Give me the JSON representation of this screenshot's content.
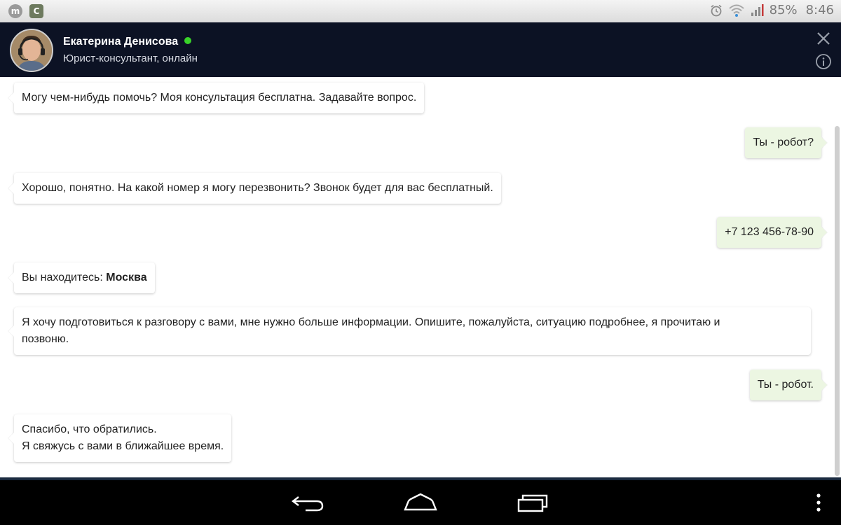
{
  "status_bar": {
    "battery": "85%",
    "time": "8:46",
    "icons": [
      "app-m-icon",
      "app-c-icon",
      "alarm-icon",
      "wifi-icon",
      "signal-icon"
    ]
  },
  "header": {
    "agent_name": "Екатерина Денисова",
    "agent_role": "Юрист-консультант, онлайн",
    "status_color": "#39d429",
    "background_color": "#0c1224"
  },
  "messages": [
    {
      "side": "in",
      "lines": [
        "Могу чем-нибудь помочь? Моя консультация бесплатна. Задавайте вопрос."
      ]
    },
    {
      "side": "out",
      "lines": [
        "Ты - робот?"
      ]
    },
    {
      "side": "in",
      "lines": [
        "Хорошо, понятно. На какой номер я могу перезвонить? Звонок будет для вас бесплатный."
      ]
    },
    {
      "side": "out",
      "lines": [
        "+7 123 456-78-90"
      ]
    },
    {
      "side": "in",
      "prefix": "Вы находитесь: ",
      "bold": "Москва"
    },
    {
      "side": "in",
      "lines": [
        "Я хочу подготовиться к разговору с вами, мне нужно больше информации. Опишите, пожалуйста, ситуацию подробнее, я прочитаю и",
        "позвоню."
      ]
    },
    {
      "side": "out",
      "lines": [
        "Ты - робот."
      ]
    },
    {
      "side": "in",
      "lines": [
        "Спасибо, что обратились.",
        "Я свяжусь с вами в ближайшее время."
      ]
    }
  ],
  "colors": {
    "incoming_bubble": "#ffffff",
    "outgoing_bubble": "#ecf6e2"
  },
  "navbar": {
    "icons": [
      "back-icon",
      "home-icon",
      "recent-apps-icon",
      "menu-icon"
    ]
  }
}
